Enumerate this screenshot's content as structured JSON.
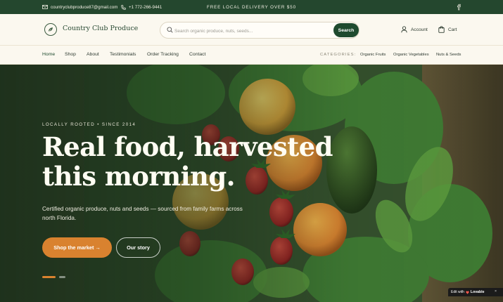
{
  "topbar": {
    "email": "countryclubproduce87@gmail.com",
    "phone": "+1 772-266-9441",
    "promo": "FREE LOCAL DELIVERY OVER $50"
  },
  "header": {
    "brand": "Country Club Produce",
    "search_placeholder": "Search organic produce, nuts, seeds...",
    "search_button": "Search",
    "account": "Account",
    "cart": "Cart"
  },
  "nav": {
    "items": [
      "Home",
      "Shop",
      "About",
      "Testimonials",
      "Order Tracking",
      "Contact"
    ],
    "categories_label": "CATEGORIES:",
    "categories": [
      "Organic Fruits",
      "Organic Vegetables",
      "Nuts & Seeds"
    ]
  },
  "hero": {
    "eyebrow": "LOCALLY ROOTED • SINCE 2014",
    "headline_line1": "Real food, harvested",
    "headline_line2": "this morning.",
    "subtitle": "Certified organic produce, nuts and seeds — sourced from family farms across north Florida.",
    "primary_cta": "Shop the market →",
    "secondary_cta": "Our story"
  },
  "badge": {
    "edit_with": "Edit with",
    "brand": "Lovable",
    "close": "×"
  },
  "colors": {
    "topbar": "#24472e",
    "brand_green": "#1e4a2e",
    "accent_orange": "#d9822f",
    "cream": "#fbf8ef"
  }
}
